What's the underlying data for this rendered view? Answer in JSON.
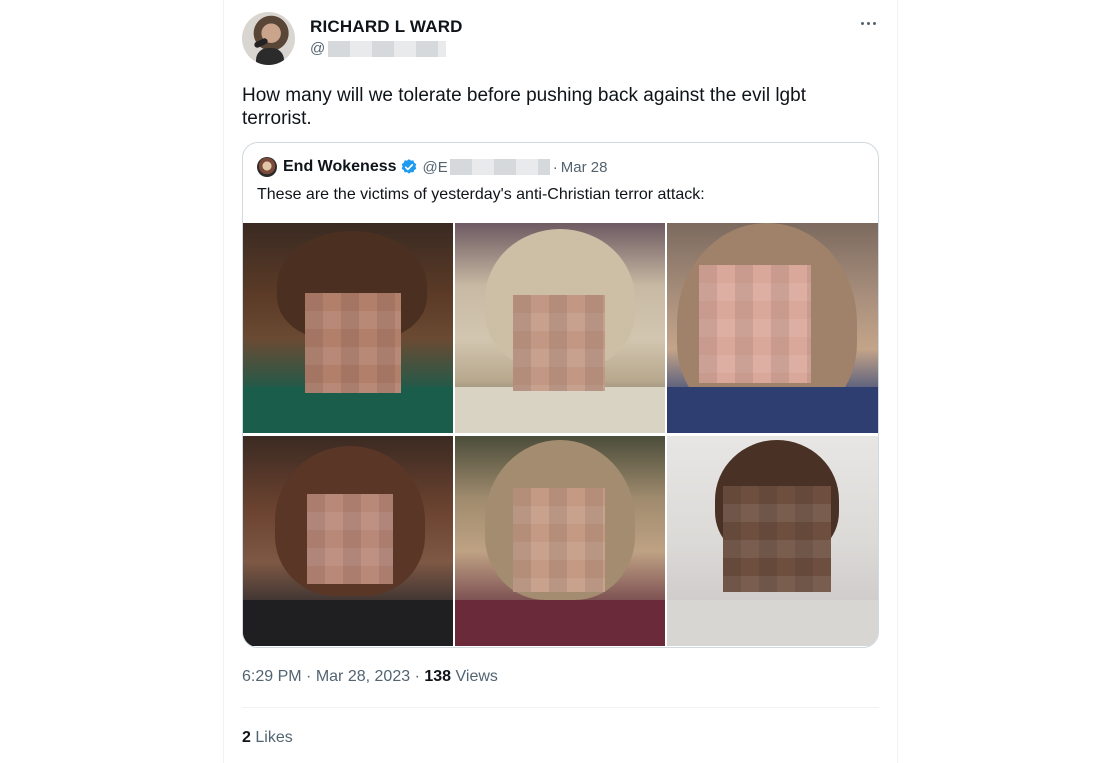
{
  "author": {
    "name": "RICHARD L WARD",
    "handle_prefix": "@"
  },
  "tweet": {
    "text": "How many will we tolerate before pushing back against the evil lgbt terrorist."
  },
  "quoted_tweet": {
    "name": "End Wokeness",
    "handle_prefix": "@E",
    "separator": "·",
    "date": "Mar 28",
    "text": "These are the victims of yesterday's anti-Christian terror attack:",
    "verified_color": "#1d9bf0",
    "photo_count": 6
  },
  "meta": {
    "time": "6:29 PM",
    "separator1": "·",
    "date": "Mar 28, 2023",
    "separator2": "·",
    "views_count": "138",
    "views_label": "Views"
  },
  "engagement": {
    "likes_count": "2",
    "likes_label": "Likes"
  },
  "icons": {
    "more": "more-dots-icon",
    "verified": "verified-badge-icon"
  }
}
